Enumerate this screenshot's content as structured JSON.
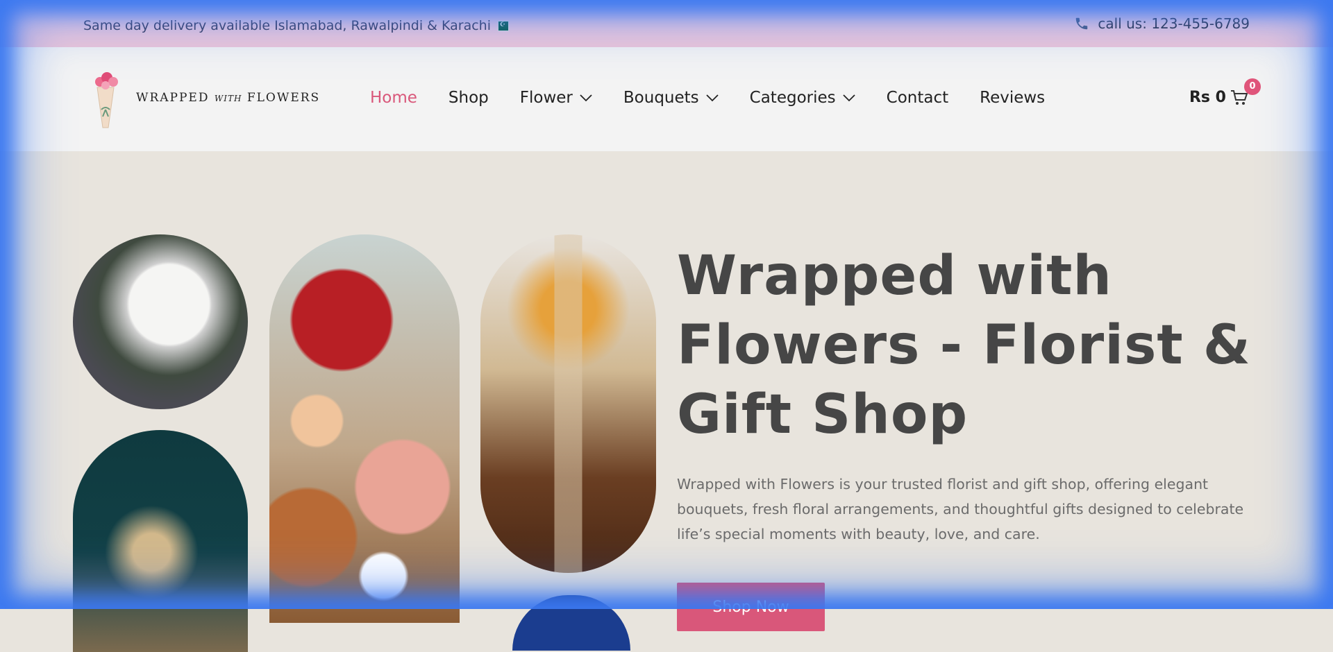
{
  "topbar": {
    "delivery_text": "Same day delivery available Islamabad, Rawalpindi & Karachi",
    "flag_icon": "pakistan-flag-icon",
    "phone_icon": "phone-icon",
    "phone_text": "call us: 123-455-6789"
  },
  "header": {
    "logo_text_main1": "WRAPPED",
    "logo_text_with": "WITH",
    "logo_text_main2": "FLOWERS",
    "nav": [
      {
        "label": "Home",
        "active": true
      },
      {
        "label": "Shop"
      },
      {
        "label": "Flower",
        "dropdown": true
      },
      {
        "label": "Bouquets",
        "dropdown": true
      },
      {
        "label": "Categories",
        "dropdown": true
      },
      {
        "label": "Contact"
      },
      {
        "label": "Reviews"
      }
    ],
    "cart_total": "Rs 0",
    "cart_count": "0",
    "accent": "#d9577a"
  },
  "hero": {
    "title": "Wrapped with Flowers - Florist & Gift Shop",
    "description": "Wrapped with Flowers is your trusted florist and gift shop, offering elegant bouquets, fresh floral arrangements, and thoughtful gifts designed to celebrate life’s special moments with beauty, love, and care.",
    "button_label": "Shop Now"
  }
}
